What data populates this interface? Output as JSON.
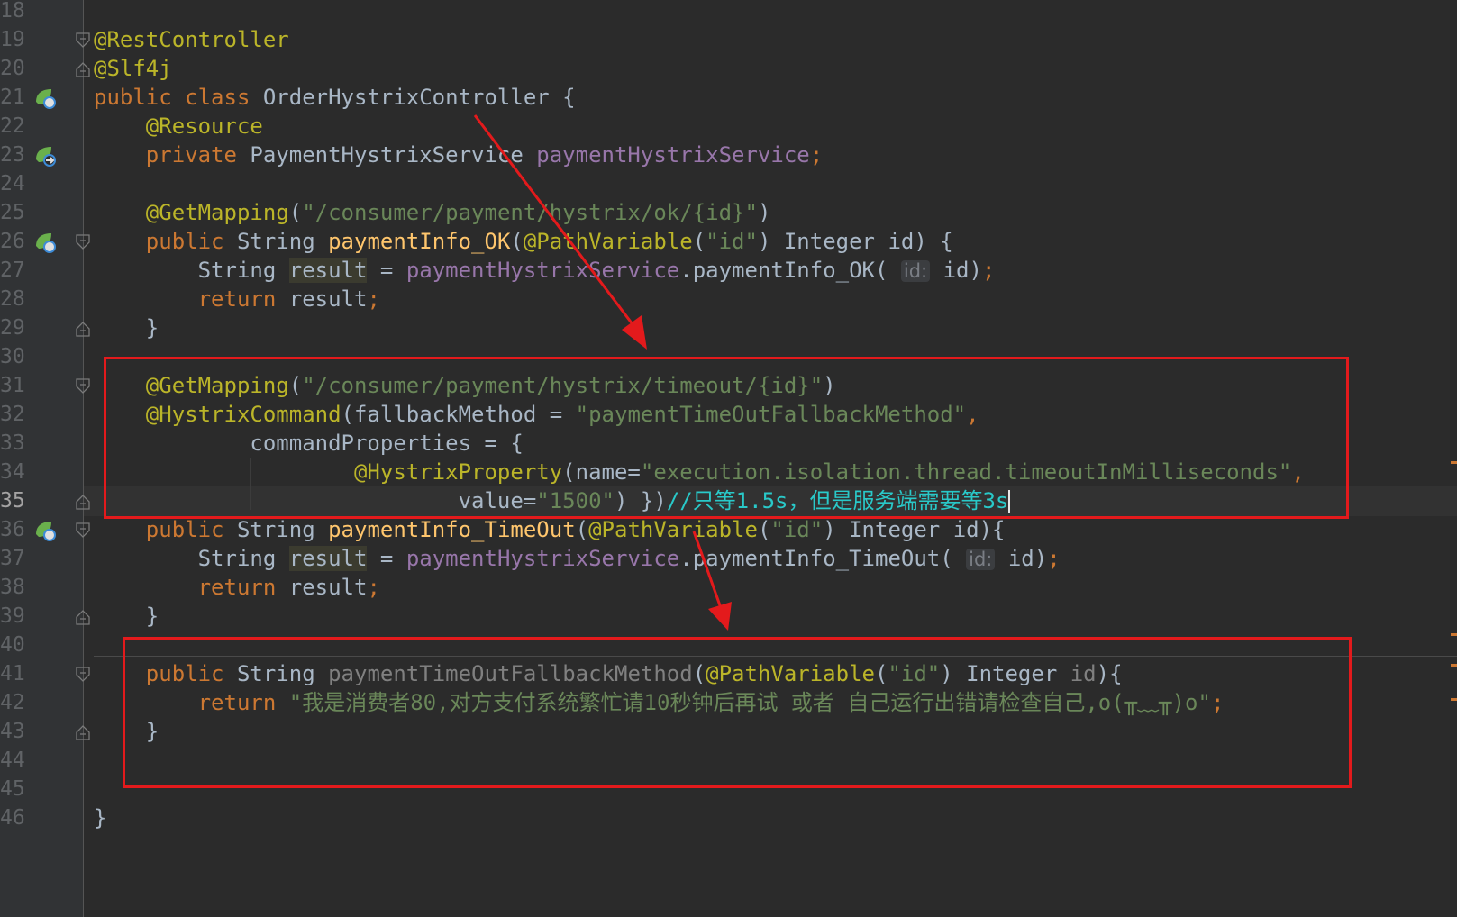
{
  "editor": {
    "gutter_lines": [
      {
        "n": "18"
      },
      {
        "n": "19",
        "fold": "open"
      },
      {
        "n": "20",
        "fold": "close"
      },
      {
        "n": "21",
        "icon": "spring-bean-icon"
      },
      {
        "n": "22"
      },
      {
        "n": "23",
        "icon": "autowired-navigate-icon"
      },
      {
        "n": "24"
      },
      {
        "n": "25"
      },
      {
        "n": "26",
        "icon": "web-endpoint-icon",
        "fold": "open"
      },
      {
        "n": "27"
      },
      {
        "n": "28"
      },
      {
        "n": "29",
        "fold": "close"
      },
      {
        "n": "30"
      },
      {
        "n": "31",
        "fold": "open"
      },
      {
        "n": "32"
      },
      {
        "n": "33"
      },
      {
        "n": "34"
      },
      {
        "n": "35",
        "fold": "close",
        "active": true
      },
      {
        "n": "36",
        "icon": "web-endpoint-icon",
        "fold": "open"
      },
      {
        "n": "37"
      },
      {
        "n": "38"
      },
      {
        "n": "39",
        "fold": "close"
      },
      {
        "n": "40"
      },
      {
        "n": "41",
        "fold": "open"
      },
      {
        "n": "42"
      },
      {
        "n": "43",
        "fold": "close"
      },
      {
        "n": "44"
      },
      {
        "n": "45"
      },
      {
        "n": "46"
      }
    ],
    "code_lines": [
      [],
      [
        [
          "ann",
          "@RestController"
        ]
      ],
      [
        [
          "ann",
          "@Slf4j"
        ]
      ],
      [
        [
          "kw",
          "public class "
        ],
        [
          "default",
          "OrderHystrixController {"
        ]
      ],
      [
        [
          "default",
          "    "
        ],
        [
          "ann",
          "@Resource"
        ]
      ],
      [
        [
          "default",
          "    "
        ],
        [
          "kw",
          "private "
        ],
        [
          "default",
          "PaymentHystrixService "
        ],
        [
          "field",
          "paymentHystrixService"
        ],
        [
          "kw",
          ";"
        ]
      ],
      [],
      [
        [
          "default",
          "    "
        ],
        [
          "ann",
          "@GetMapping"
        ],
        [
          "default",
          "("
        ],
        [
          "str",
          "\"/consumer/payment/hystrix/ok/{id}\""
        ],
        [
          "default",
          ")"
        ]
      ],
      [
        [
          "default",
          "    "
        ],
        [
          "kw",
          "public "
        ],
        [
          "default",
          "String "
        ],
        [
          "method",
          "paymentInfo_OK"
        ],
        [
          "default",
          "("
        ],
        [
          "ann",
          "@PathVariable"
        ],
        [
          "default",
          "("
        ],
        [
          "str",
          "\"id\""
        ],
        [
          "default",
          ") Integer id) {"
        ]
      ],
      [
        [
          "default",
          "        String "
        ],
        [
          "hl",
          "result"
        ],
        [
          "default",
          " = "
        ],
        [
          "field",
          "paymentHystrixService"
        ],
        [
          "default",
          ".paymentInfo_OK( "
        ],
        [
          "hint",
          "id:"
        ],
        [
          "default",
          " id)"
        ],
        [
          "kw",
          ";"
        ]
      ],
      [
        [
          "default",
          "        "
        ],
        [
          "kw",
          "return "
        ],
        [
          "default",
          "result"
        ],
        [
          "kw",
          ";"
        ]
      ],
      [
        [
          "default",
          "    }"
        ]
      ],
      [],
      [
        [
          "default",
          "    "
        ],
        [
          "ann",
          "@GetMapping"
        ],
        [
          "default",
          "("
        ],
        [
          "str",
          "\"/consumer/payment/hystrix/timeout/{id}\""
        ],
        [
          "default",
          ")"
        ]
      ],
      [
        [
          "default",
          "    "
        ],
        [
          "ann",
          "@HystrixCommand"
        ],
        [
          "default",
          "(fallbackMethod = "
        ],
        [
          "str",
          "\"paymentTimeOutFallbackMethod\""
        ],
        [
          "kw",
          ","
        ]
      ],
      [
        [
          "default",
          "            commandProperties = {"
        ]
      ],
      [
        [
          "default",
          "                    "
        ],
        [
          "ann",
          "@HystrixProperty"
        ],
        [
          "default",
          "(name="
        ],
        [
          "str",
          "\"execution.isolation.thread.timeoutInMilliseconds\""
        ],
        [
          "kw",
          ","
        ]
      ],
      [
        [
          "default",
          "                            value="
        ],
        [
          "str",
          "\"1500\""
        ],
        [
          "default",
          ") })"
        ],
        [
          "cmt",
          "//只等1.5s，但是服务端需要等3s"
        ],
        [
          "caret",
          ""
        ]
      ],
      [
        [
          "default",
          "    "
        ],
        [
          "kw",
          "public "
        ],
        [
          "default",
          "String "
        ],
        [
          "method",
          "paymentInfo_TimeOut"
        ],
        [
          "default",
          "("
        ],
        [
          "ann",
          "@PathVariable"
        ],
        [
          "default",
          "("
        ],
        [
          "str",
          "\"id\""
        ],
        [
          "default",
          ") Integer id){"
        ]
      ],
      [
        [
          "default",
          "        String "
        ],
        [
          "hl",
          "result"
        ],
        [
          "default",
          " = "
        ],
        [
          "field",
          "paymentHystrixService"
        ],
        [
          "default",
          ".paymentInfo_TimeOut( "
        ],
        [
          "hint",
          "id:"
        ],
        [
          "default",
          " id)"
        ],
        [
          "kw",
          ";"
        ]
      ],
      [
        [
          "default",
          "        "
        ],
        [
          "kw",
          "return "
        ],
        [
          "default",
          "result"
        ],
        [
          "kw",
          ";"
        ]
      ],
      [
        [
          "default",
          "    }"
        ]
      ],
      [],
      [
        [
          "default",
          "    "
        ],
        [
          "kw",
          "public "
        ],
        [
          "default",
          "String "
        ],
        [
          "unused",
          "paymentTimeOutFallbackMethod"
        ],
        [
          "default",
          "("
        ],
        [
          "ann",
          "@PathVariable"
        ],
        [
          "default",
          "("
        ],
        [
          "str",
          "\"id\""
        ],
        [
          "default",
          ") Integer "
        ],
        [
          "unused",
          "id"
        ],
        [
          "default",
          "){"
        ]
      ],
      [
        [
          "default",
          "        "
        ],
        [
          "kw",
          "return "
        ],
        [
          "str",
          "\"我是消费者80,对方支付系统繁忙请10秒钟后再试 或者 自己运行出错请检查自己,o(╥﹏╥)o\""
        ],
        [
          "kw",
          ";"
        ]
      ],
      [
        [
          "default",
          "    }"
        ]
      ],
      [],
      [],
      [
        [
          "default",
          "}"
        ]
      ]
    ]
  },
  "colors": {
    "background": "#2b2b2b",
    "keyword": "#cc7832",
    "annotation": "#bbb529",
    "string": "#6a8759",
    "field": "#9876aa",
    "method": "#ffc66d",
    "comment": "#29c9c9",
    "highlight_box": "#e31a1c"
  }
}
